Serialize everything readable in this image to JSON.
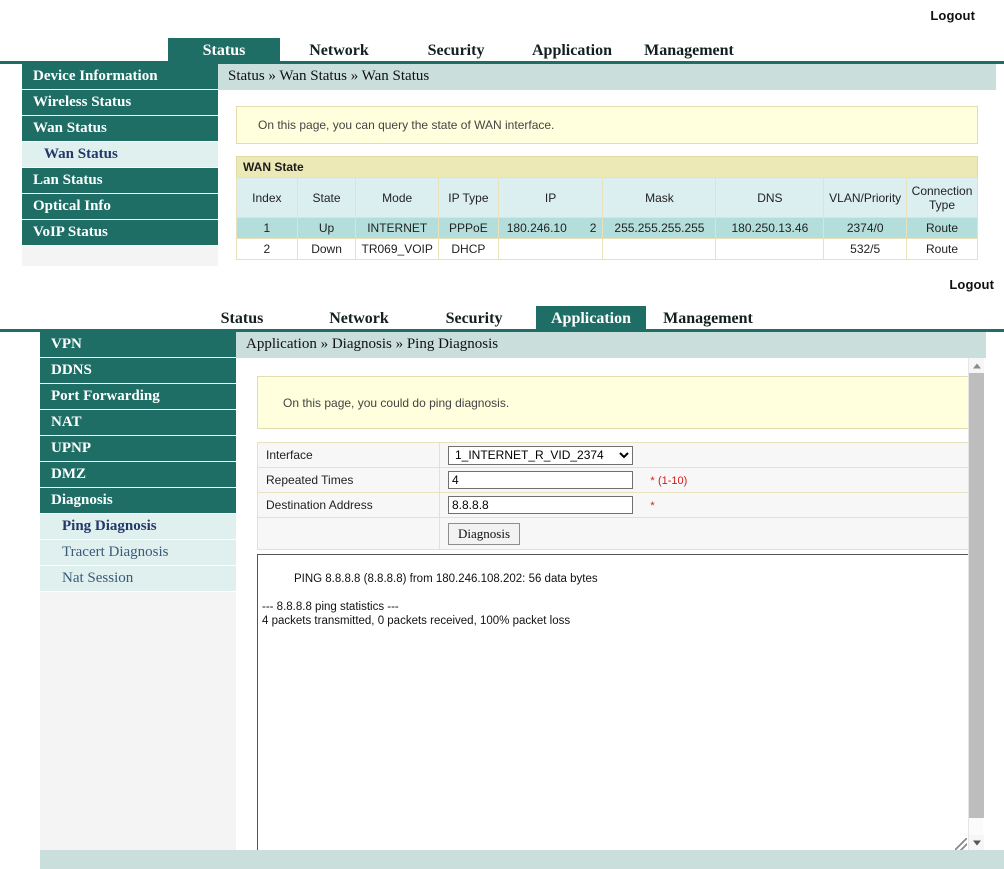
{
  "colors": {
    "teal": "#1e6e66",
    "breadcrumb_bg": "#cadedb",
    "info_bg": "#ffffdd",
    "table_title_bg": "#ece9b7",
    "table_head_bg": "#dbeef0",
    "row_highlight_bg": "#b4dedb",
    "required_red": "#d11a1a"
  },
  "top_page": {
    "logout_label": "Logout",
    "nav": [
      {
        "label": "Status",
        "active": true
      },
      {
        "label": "Network",
        "active": false
      },
      {
        "label": "Security",
        "active": false
      },
      {
        "label": "Application",
        "active": false
      },
      {
        "label": "Management",
        "active": false
      }
    ],
    "sidebar": [
      {
        "label": "Device Information",
        "type": "main"
      },
      {
        "label": "Wireless Status",
        "type": "main"
      },
      {
        "label": "Wan Status",
        "type": "main"
      },
      {
        "label": "Wan Status",
        "type": "sub",
        "active": true
      },
      {
        "label": "Lan Status",
        "type": "main"
      },
      {
        "label": "Optical Info",
        "type": "main"
      },
      {
        "label": "VoIP Status",
        "type": "main"
      }
    ],
    "breadcrumb": "Status » Wan Status » Wan Status",
    "info_text": "On this page, you can query the state of WAN interface.",
    "table": {
      "title": "WAN State",
      "headers": [
        "Index",
        "State",
        "Mode",
        "IP Type",
        "IP",
        "Mask",
        "DNS",
        "VLAN/Priority",
        "Connection Type"
      ],
      "rows": [
        {
          "index": "1",
          "state": "Up",
          "mode": "INTERNET",
          "ip_type": "PPPoE",
          "ip": "180.246.10",
          "ip_overflow": "2",
          "mask": "255.255.255.255",
          "dns": "180.250.13.46",
          "vlan_priority": "2374/0",
          "connection_type": "Route"
        },
        {
          "index": "2",
          "state": "Down",
          "mode": "TR069_VOIP",
          "ip_type": "DHCP",
          "ip": "",
          "ip_overflow": "",
          "mask": "",
          "dns": "",
          "vlan_priority": "532/5",
          "connection_type": "Route"
        }
      ]
    }
  },
  "bottom_page": {
    "logout_label": "Logout",
    "nav": [
      {
        "label": "Status",
        "active": false
      },
      {
        "label": "Network",
        "active": false
      },
      {
        "label": "Security",
        "active": false
      },
      {
        "label": "Application",
        "active": true
      },
      {
        "label": "Management",
        "active": false
      }
    ],
    "sidebar": [
      {
        "label": "VPN",
        "type": "main"
      },
      {
        "label": "DDNS",
        "type": "main"
      },
      {
        "label": "Port Forwarding",
        "type": "main"
      },
      {
        "label": "NAT",
        "type": "main"
      },
      {
        "label": "UPNP",
        "type": "main"
      },
      {
        "label": "DMZ",
        "type": "main"
      },
      {
        "label": "Diagnosis",
        "type": "main"
      },
      {
        "label": "Ping Diagnosis",
        "type": "sub",
        "active": true
      },
      {
        "label": "Tracert Diagnosis",
        "type": "sub",
        "active": false
      },
      {
        "label": "Nat Session",
        "type": "sub",
        "active": false
      }
    ],
    "breadcrumb": "Application » Diagnosis » Ping Diagnosis",
    "info_text": "On this page, you could do ping diagnosis.",
    "form": {
      "interface_label": "Interface",
      "interface_value": "1_INTERNET_R_VID_2374",
      "interface_options": [
        "1_INTERNET_R_VID_2374"
      ],
      "repeated_label": "Repeated Times",
      "repeated_value": "4",
      "repeated_hint_star": "*",
      "repeated_hint_range": "(1-10)",
      "destination_label": "Destination Address",
      "destination_value": "8.8.8.8",
      "destination_hint_star": "*",
      "submit_label": "Diagnosis"
    },
    "result_text": "PING 8.8.8.8 (8.8.8.8) from 180.246.108.202: 56 data bytes\n\n--- 8.8.8.8 ping statistics ---\n4 packets transmitted, 0 packets received, 100% packet loss"
  }
}
